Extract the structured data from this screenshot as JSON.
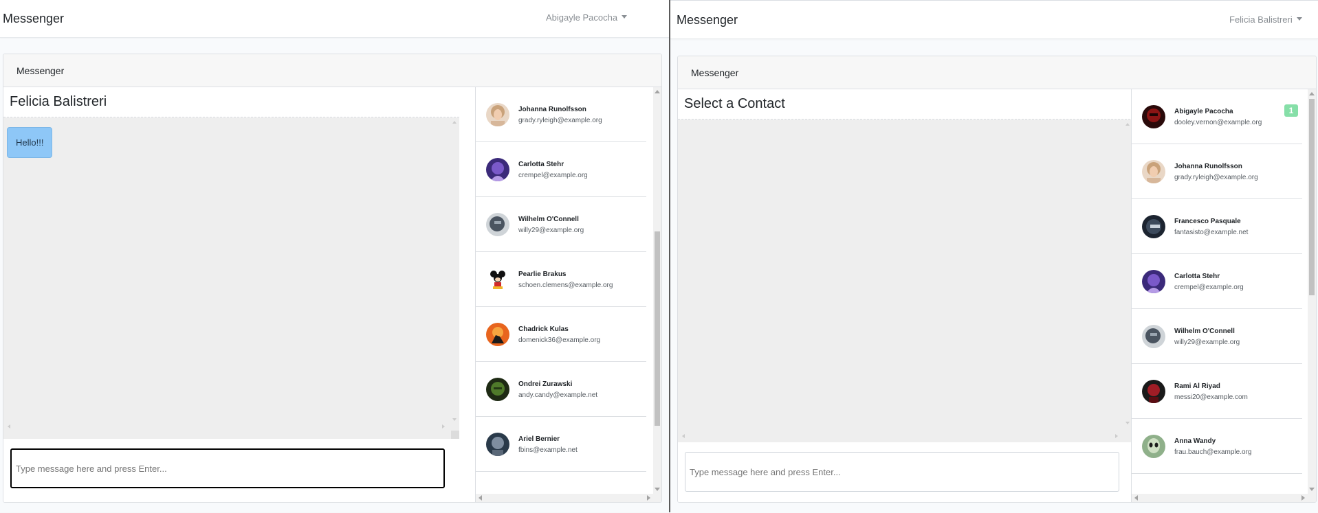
{
  "left": {
    "navbar": {
      "brand": "Messenger",
      "user": "Abigayle Pacocha"
    },
    "card_title": "Messenger",
    "conversation": {
      "title": "Felicia Balistreri",
      "messages": [
        {
          "text": "Hello!!!"
        }
      ],
      "input_placeholder": "Type message here and press Enter..."
    },
    "contacts": [
      {
        "name": "Johanna Runolfsson",
        "email": "grady.ryleigh@example.org",
        "avatar": "portrait-blonde"
      },
      {
        "name": "Carlotta Stehr",
        "email": "crempel@example.org",
        "avatar": "portrait-purple"
      },
      {
        "name": "Wilhelm O'Connell",
        "email": "willy29@example.org",
        "avatar": "portrait-helmet"
      },
      {
        "name": "Pearlie Brakus",
        "email": "schoen.clemens@example.org",
        "avatar": "cartoon-mouse"
      },
      {
        "name": "Chadrick Kulas",
        "email": "domenick36@example.org",
        "avatar": "sunset-rider"
      },
      {
        "name": "Ondrei Zurawski",
        "email": "andy.candy@example.net",
        "avatar": "green-hulk"
      },
      {
        "name": "Ariel Bernier",
        "email": "fbins@example.net",
        "avatar": "portrait-dark"
      }
    ]
  },
  "right": {
    "navbar": {
      "brand": "Messenger",
      "user": "Felicia Balistreri"
    },
    "card_title": "Messenger",
    "conversation": {
      "title": "Select a Contact",
      "messages": [],
      "input_placeholder": "Type message here and press Enter..."
    },
    "contacts": [
      {
        "name": "Abigayle Pacocha",
        "email": "dooley.vernon@example.org",
        "avatar": "red-mask",
        "unread": "1"
      },
      {
        "name": "Johanna Runolfsson",
        "email": "grady.ryleigh@example.org",
        "avatar": "portrait-blonde"
      },
      {
        "name": "Francesco Pasquale",
        "email": "fantasisto@example.net",
        "avatar": "logo-dark"
      },
      {
        "name": "Carlotta Stehr",
        "email": "crempel@example.org",
        "avatar": "portrait-purple"
      },
      {
        "name": "Wilhelm O'Connell",
        "email": "willy29@example.org",
        "avatar": "portrait-helmet"
      },
      {
        "name": "Rami Al Riyad",
        "email": "messi20@example.com",
        "avatar": "portrait-red"
      },
      {
        "name": "Anna Wandy",
        "email": "frau.bauch@example.org",
        "avatar": "alien-green"
      }
    ]
  },
  "colors": {
    "message_bubble": "#8ec7f7",
    "unread_badge": "#86dfa8",
    "feed_background": "#eeeeee"
  }
}
